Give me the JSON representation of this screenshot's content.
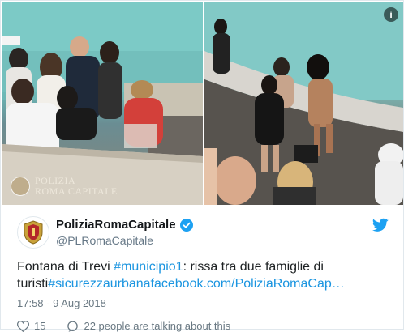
{
  "media": {
    "watermark_text": "POLIZIA\nROMA CAPITALE",
    "info_icon": "i"
  },
  "account": {
    "display_name": "PoliziaRomaCapitale",
    "handle": "@PLRomaCapitale",
    "avatar_icon": "shield-crest-icon"
  },
  "tweet": {
    "text_plain_1": "Fontana di Trevi ",
    "hashtag_1": "#municipio1",
    "text_plain_2": ": rissa tra due famiglie di turisti",
    "hashtag_2": "#sicurezzaurbana",
    "link": "facebook.com/PoliziaRomaCap…"
  },
  "timestamp": "17:58 - 9 Aug 2018",
  "actions": {
    "likes_count": "15",
    "talking_text": "22 people are talking about this"
  },
  "colors": {
    "link": "#1b95e0",
    "verified": "#1da1f2",
    "twitter_brand": "#1da1f2",
    "muted": "#657786"
  }
}
